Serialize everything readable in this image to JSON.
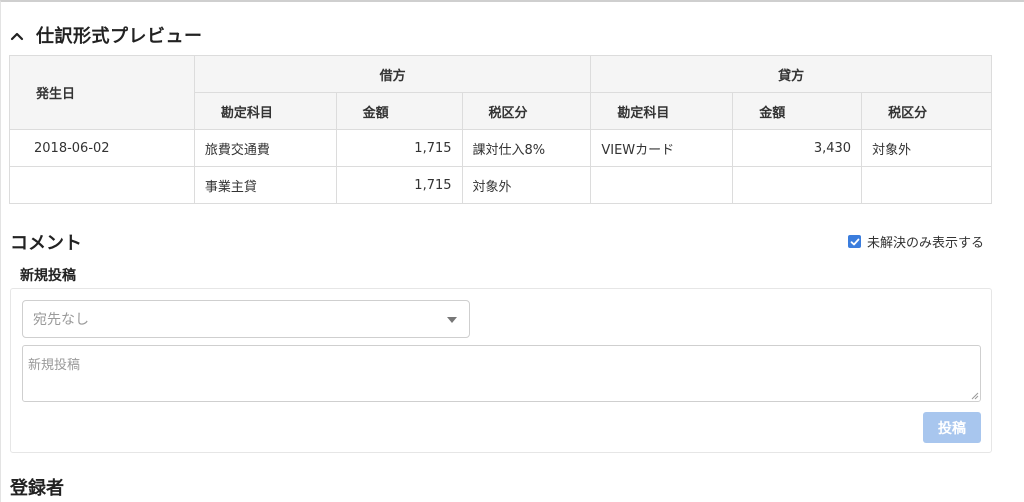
{
  "preview": {
    "title": "仕訳形式プレビュー",
    "headers": {
      "date": "発生日",
      "debit": "借方",
      "credit": "貸方",
      "account": "勘定科目",
      "amount": "金額",
      "tax": "税区分"
    },
    "rows": [
      {
        "date": "2018-06-02",
        "debit_account": "旅費交通費",
        "debit_amount": "1,715",
        "debit_tax": "課対仕入8%",
        "credit_account": "VIEWカード",
        "credit_amount": "3,430",
        "credit_tax": "対象外"
      },
      {
        "date": "",
        "debit_account": "事業主貸",
        "debit_amount": "1,715",
        "debit_tax": "対象外",
        "credit_account": "",
        "credit_amount": "",
        "credit_tax": ""
      }
    ]
  },
  "comment": {
    "title": "コメント",
    "unresolved_only_label": "未解決のみ表示する",
    "unresolved_only_checked": true,
    "new_post_label": "新規投稿",
    "recipient_placeholder": "宛先なし",
    "body_placeholder": "新規投稿",
    "post_button_label": "投稿"
  },
  "registrant": {
    "title": "登録者"
  },
  "colors": {
    "accent": "#3b7ddd",
    "post_button_disabled": "#a8c6ee",
    "header_bg": "#f5f5f5",
    "border": "#dcdcdc"
  },
  "icons": {
    "collapse": "chevron-up-icon",
    "dropdown": "caret-down-icon",
    "checkbox": "checkmark-icon"
  }
}
